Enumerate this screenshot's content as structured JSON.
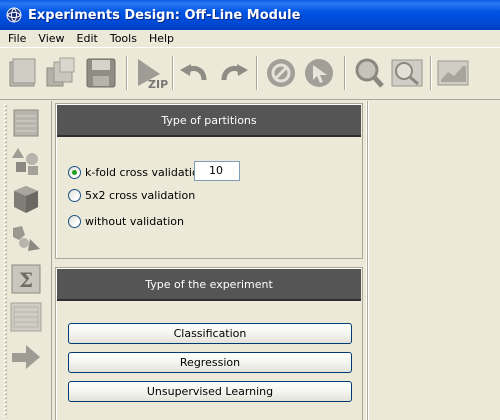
{
  "window": {
    "title": "Experiments Design: Off-Line Module"
  },
  "menu": {
    "items": [
      "File",
      "View",
      "Edit",
      "Tools",
      "Help"
    ]
  },
  "toolbar": {
    "buttons": [
      "new-icon",
      "open-icon",
      "save-icon",
      "zip-icon",
      "undo-icon",
      "redo-icon",
      "stop-icon",
      "pointer-icon",
      "zoom-in-icon",
      "zoom-out-icon",
      "chart-icon"
    ],
    "zip_label": "ZIP"
  },
  "leftbar": {
    "buttons": [
      "datasets-icon",
      "preprocess-icon",
      "method-icon",
      "postprocess-icon",
      "statistical-tests-icon",
      "visualization-icon",
      "connection-arrow-icon"
    ],
    "sigma_label": "Σ"
  },
  "partitions": {
    "title": "Type of partitions",
    "options": [
      {
        "label": "k-fold cross validation",
        "checked": true
      },
      {
        "label": "5x2 cross validation",
        "checked": false
      },
      {
        "label": "without validation",
        "checked": false
      }
    ],
    "kfold_value": "10"
  },
  "experiment": {
    "title": "Type of the experiment",
    "buttons": [
      "Classification",
      "Regression",
      "Unsupervised Learning"
    ]
  },
  "colors": {
    "titlebar": "#0054e3",
    "header": "#555555",
    "background": "#ece9d8"
  }
}
